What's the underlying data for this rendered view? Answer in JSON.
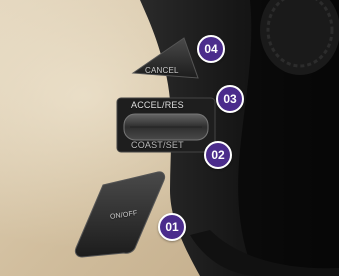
{
  "buttons": {
    "cancel": "CANCEL",
    "accel_res": "ACCEL/RES",
    "coast_set": "COAST/SET",
    "on_off": "ON/OFF"
  },
  "callouts": {
    "on_off": "01",
    "coast_set": "02",
    "accel_res": "03",
    "cancel": "04"
  },
  "colors": {
    "callout_fill": "#4b2c8c",
    "callout_border": "#ffffff"
  }
}
